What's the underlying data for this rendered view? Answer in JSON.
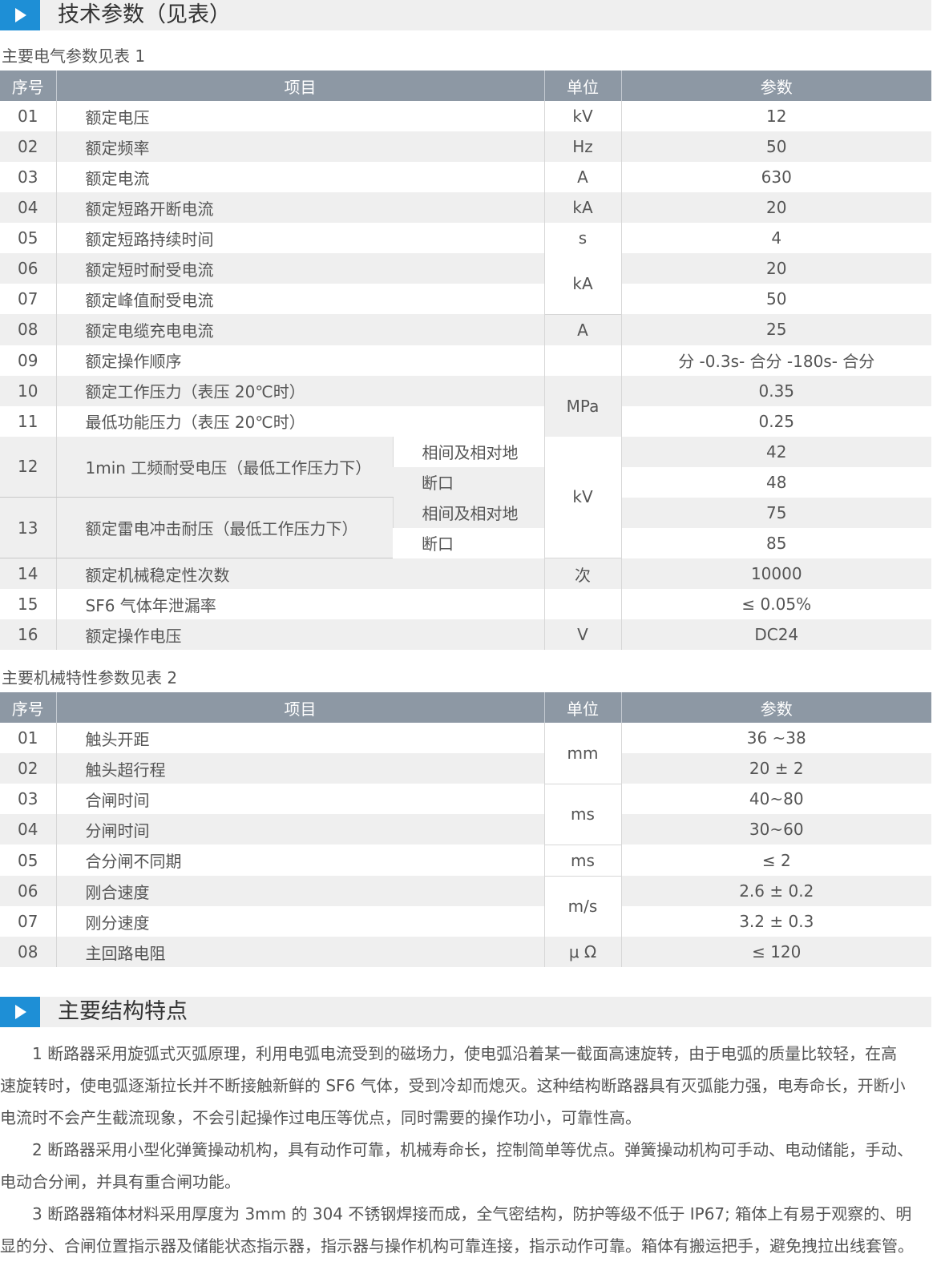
{
  "section1": {
    "title": "技术参数（见表）"
  },
  "table1": {
    "caption": "主要电气参数见表 1",
    "headers": [
      "序号",
      "项目",
      "单位",
      "参数"
    ],
    "rows": [
      {
        "no": "01",
        "item": "额定电压",
        "unit": "kV",
        "value": "12"
      },
      {
        "no": "02",
        "item": "额定频率",
        "unit": "Hz",
        "value": "50"
      },
      {
        "no": "03",
        "item": "额定电流",
        "unit": "A",
        "value": "630"
      },
      {
        "no": "04",
        "item": "额定短路开断电流",
        "unit": "kA",
        "value": "20"
      },
      {
        "no": "05",
        "item": "额定短路持续时间",
        "unit": "s",
        "value": "4"
      },
      {
        "no": "06",
        "item": "额定短时耐受电流",
        "unit": "kA",
        "value": "20"
      },
      {
        "no": "07",
        "item": "额定峰值耐受电流",
        "value": "50"
      },
      {
        "no": "08",
        "item": "额定电缆充电电流",
        "unit": "A",
        "value": "25"
      },
      {
        "no": "09",
        "item": "额定操作顺序",
        "unit": "",
        "value": "分 -0.3s- 合分 -180s- 合分"
      },
      {
        "no": "10",
        "item": "额定工作压力（表压 20℃时）",
        "unit": "MPa",
        "value": "0.35"
      },
      {
        "no": "11",
        "item": "最低功能压力（表压 20℃时）",
        "value": "0.25"
      },
      {
        "no": "12",
        "item": "1min 工频耐受电压（最低工作压力下）",
        "unit": "kV",
        "subs": [
          {
            "label": "相间及相对地",
            "value": "42"
          },
          {
            "label": "断口",
            "value": "48"
          }
        ]
      },
      {
        "no": "13",
        "item": "额定雷电冲击耐压（最低工作压力下）",
        "subs": [
          {
            "label": "相间及相对地",
            "value": "75"
          },
          {
            "label": "断口",
            "value": "85"
          }
        ]
      },
      {
        "no": "14",
        "item": "额定机械稳定性次数",
        "unit": "次",
        "value": "10000"
      },
      {
        "no": "15",
        "item": "SF6 气体年泄漏率",
        "unit": "",
        "value": "≤ 0.05%"
      },
      {
        "no": "16",
        "item": "额定操作电压",
        "unit": "V",
        "value": "DC24"
      }
    ]
  },
  "table2": {
    "caption": "主要机械特性参数见表 2",
    "headers": [
      "序号",
      "项目",
      "单位",
      "参数"
    ],
    "rows": [
      {
        "no": "01",
        "item": "触头开距",
        "unit": "mm",
        "value": "36 ~38"
      },
      {
        "no": "02",
        "item": "触头超行程",
        "value": "20 ± 2"
      },
      {
        "no": "03",
        "item": "合闸时间",
        "unit": "ms",
        "value": "40~80"
      },
      {
        "no": "04",
        "item": "分闸时间",
        "value": "30~60"
      },
      {
        "no": "05",
        "item": "合分闸不同期",
        "unit": "ms",
        "value": "≤ 2"
      },
      {
        "no": "06",
        "item": "刚合速度",
        "unit": "m/s",
        "value": "2.6 ± 0.2"
      },
      {
        "no": "07",
        "item": "刚分速度",
        "value": "3.2 ± 0.3"
      },
      {
        "no": "08",
        "item": "主回路电阻",
        "unit": "μ Ω",
        "value": "≤ 120"
      }
    ]
  },
  "section2": {
    "title": "主要结构特点",
    "lines": [
      "　　1 断路器采用旋弧式灭弧原理，利用电弧电流受到的磁场力，使电弧沿着某一截面高速旋转，由于电弧的质量比较轻，在高",
      "速旋转时，使电弧逐渐拉长并不断接触新鲜的 SF6 气体，受到冷却而熄灭。这种结构断路器具有灭弧能力强，电寿命长，开断小",
      "电流时不会产生截流现象，不会引起操作过电压等优点，同时需要的操作功小，可靠性高。",
      "　　2 断路器采用小型化弹簧操动机构，具有动作可靠，机械寿命长，控制简单等优点。弹簧操动机构可手动、电动储能，手动、",
      "电动合分闸，并具有重合闸功能。",
      "　　3 断路器箱体材料采用厚度为 3mm 的 304 不锈钢焊接而成，全气密结构，防护等级不低于 IP67; 箱体上有易于观察的、明",
      "显的分、合闸位置指示器及储能状态指示器，指示器与操作机构可靠连接，指示动作可靠。箱体有搬运把手，避免拽拉出线套管。"
    ]
  }
}
